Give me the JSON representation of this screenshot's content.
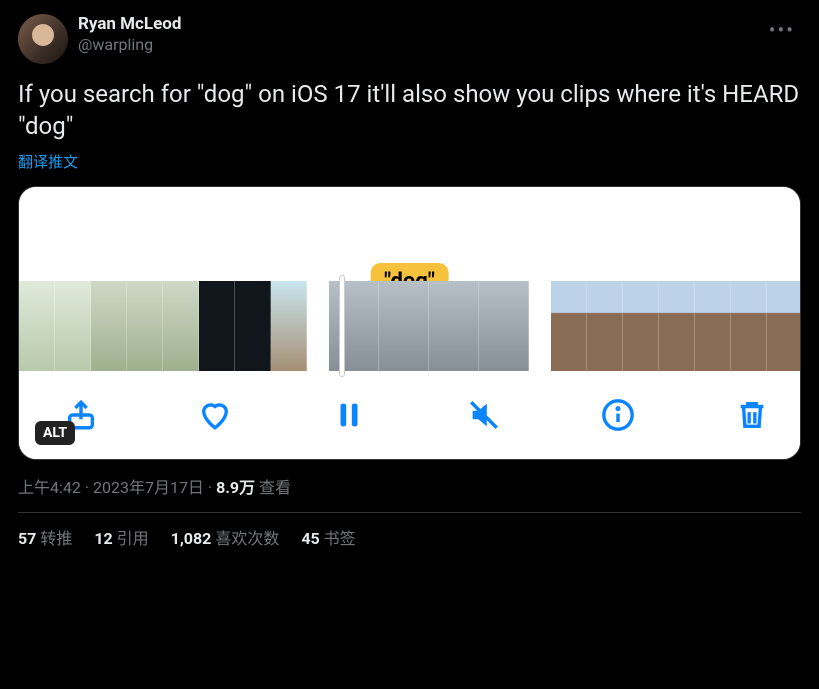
{
  "author": {
    "display_name": "Ryan McLeod",
    "handle": "@warpling"
  },
  "tweet": {
    "text": "If you search for \"dog\" on iOS 17 it'll also show you clips where it's HEARD \"dog\"",
    "translate_label": "翻译推文",
    "alt_badge": "ALT",
    "search_tag": "\"dog\""
  },
  "meta": {
    "time": "上午4:42",
    "date": "2023年7月17日",
    "views_count": "8.9万",
    "views_label": "查看",
    "dot": "·"
  },
  "stats": {
    "retweets_count": "57",
    "retweets_label": "转推",
    "quotes_count": "12",
    "quotes_label": "引用",
    "likes_count": "1,082",
    "likes_label": "喜欢次数",
    "bookmarks_count": "45",
    "bookmarks_label": "书签"
  }
}
